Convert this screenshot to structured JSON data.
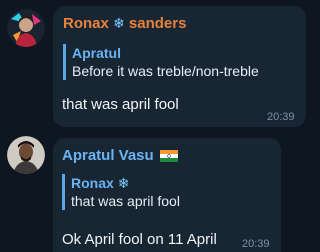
{
  "messages": [
    {
      "sender_first": "Ronax",
      "sender_last": "sanders",
      "sender_emoji": "❄",
      "sender_color": "#e8823a",
      "reply": {
        "name": "Apratul",
        "text": "Before it was treble/non-treble"
      },
      "text": "that was april fool",
      "time": "20:39",
      "avatar_icon": "person-avatar-icon"
    },
    {
      "sender_name": "Apratul Vasu",
      "sender_flag": "india-flag-icon",
      "sender_color": "#6ab3f3",
      "reply": {
        "name": "Ronax",
        "emoji": "❄",
        "text": "that was april fool"
      },
      "text": "Ok April fool on 11 April",
      "time": "20:39",
      "avatar_icon": "person-avatar-icon"
    }
  ]
}
